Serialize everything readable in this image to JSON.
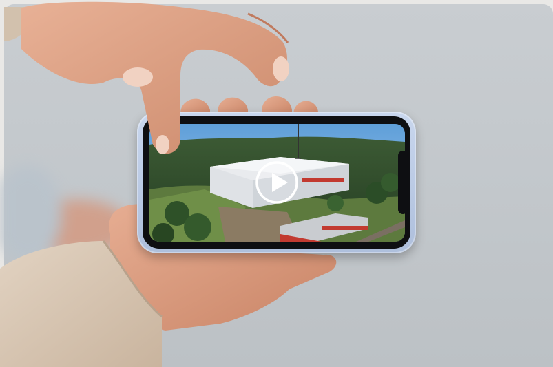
{
  "scene": {
    "description_tags": [
      "hands",
      "smartphone",
      "video-player",
      "aerial-factory-view"
    ],
    "colors": {
      "backdrop": "#c3c8cc",
      "skin": "#d89a7c",
      "sweater": "#d8c7b3",
      "phone_case": "#bccbe6",
      "sky": "#7fb3e3",
      "forest": "#2f4a2a",
      "factory_roof": "#e6e8ea",
      "accent_red": "#c23a30"
    },
    "video": {
      "play_icon": "play-icon",
      "state": "paused"
    }
  }
}
